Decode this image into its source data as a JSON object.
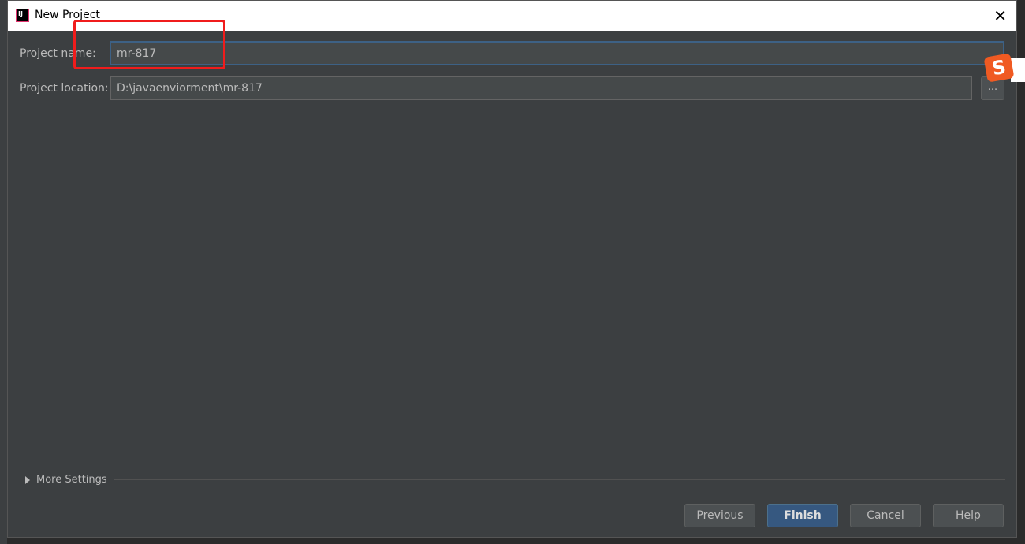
{
  "window": {
    "title": "New Project",
    "app_icon": "intellij-icon",
    "logo_text": "IJ"
  },
  "form": {
    "name_label": "Project name:",
    "name_value": "mr-817",
    "location_label": "Project location:",
    "location_value": "D:\\javaenviorment\\mr-817",
    "browse_label": "..."
  },
  "more_settings": "More Settings",
  "buttons": {
    "previous": "Previous",
    "finish": "Finish",
    "cancel": "Cancel",
    "help": "Help"
  },
  "overlay": {
    "sogou_letter": "S"
  },
  "colors": {
    "accent": "#365880",
    "highlight": "#f01c1c"
  }
}
